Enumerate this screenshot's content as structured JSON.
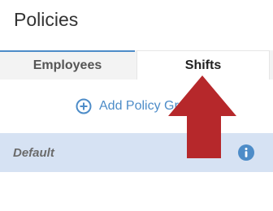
{
  "header": {
    "title": "Policies"
  },
  "tabs": [
    {
      "label": "Employees",
      "active": false
    },
    {
      "label": "Shifts",
      "active": true
    }
  ],
  "actions": {
    "add_policy_group_label": "Add Policy Group",
    "add_icon": "plus-circle-icon"
  },
  "policy_groups": [
    {
      "label": "Default",
      "info_icon": "info-icon"
    }
  ],
  "annotation": {
    "icon": "red-arrow-icon",
    "color": "#b6282b"
  },
  "colors": {
    "accent": "#4d8cc8",
    "selected_row": "#d6e2f3",
    "arrow": "#b6282b"
  }
}
